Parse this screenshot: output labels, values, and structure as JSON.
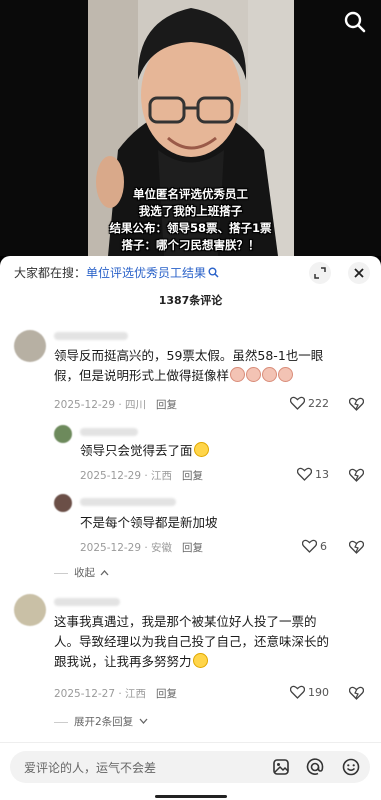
{
  "video": {
    "caption": [
      "单位匿名评选优秀员工",
      "我选了我的上班搭子",
      "结果公布：领导58票、搭子1票",
      "搭子：哪个刁民想害朕？！"
    ]
  },
  "sheet": {
    "search_prefix": "大家都在搜：",
    "search_link": "单位评选优秀员工结果",
    "comment_count": "1387条评论"
  },
  "comments": [
    {
      "text_lines": [
        "领导反而挺高兴的，59票太假。虽然58-1也一眼",
        "假，但是说明形式上做得挺像样"
      ],
      "date": "2025-12-29",
      "location": "四川",
      "reply": "回复",
      "likes": "222"
    },
    {
      "text_lines": [
        "领导只会觉得丢了面"
      ],
      "date": "2025-12-29",
      "location": "江西",
      "reply": "回复",
      "likes": "13"
    },
    {
      "text_lines": [
        "不是每个领导都是新加坡"
      ],
      "date": "2025-12-29",
      "location": "安徽",
      "reply": "回复",
      "likes": "6"
    },
    {
      "text_lines": [
        "这事我真遇过，我是那个被某位好人投了一票的",
        "人。导致经理以为我自己投了自己，还意味深长的",
        "跟我说，让我再多努努力"
      ],
      "date": "2025-12-27",
      "location": "江西",
      "reply": "回复",
      "likes": "190"
    }
  ],
  "folds": {
    "collapse": "收起",
    "expand": "展开2条回复"
  },
  "input": {
    "placeholder": "爱评论的人，运气不会差"
  },
  "icons": {
    "search": "search-icon",
    "expand": "expand-icon",
    "close": "close-icon",
    "image": "image-icon",
    "at": "at-icon",
    "emoji": "emoji-icon",
    "heart": "heart-icon",
    "dislike": "dislike-icon"
  }
}
